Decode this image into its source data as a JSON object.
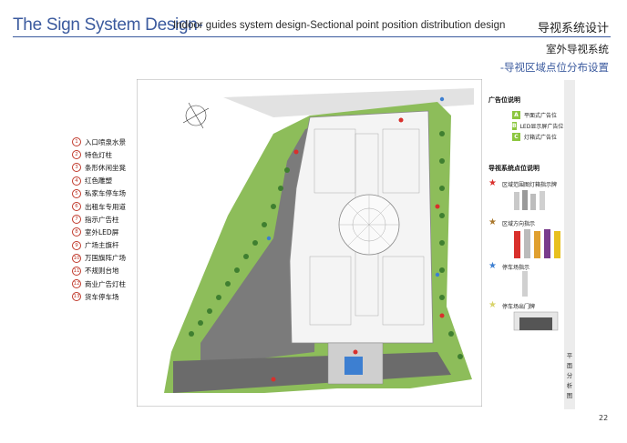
{
  "header": {
    "title": "The Sign System Design-",
    "subtitle": "Indoor guides system design-Sectional point position distribution design",
    "title_cn": "导视系统设计",
    "section_cn": "室外导视系统",
    "subsection_cn": "-导视区域点位分布设置"
  },
  "legend": [
    {
      "num": "1",
      "label": "入口喷泉水景"
    },
    {
      "num": "2",
      "label": "特色灯柱"
    },
    {
      "num": "3",
      "label": "条形休闲坐凳"
    },
    {
      "num": "4",
      "label": "红色雕塑"
    },
    {
      "num": "5",
      "label": "私家车停车场"
    },
    {
      "num": "6",
      "label": "出租车专用道"
    },
    {
      "num": "7",
      "label": "指示广告柱"
    },
    {
      "num": "8",
      "label": "室外LED屏"
    },
    {
      "num": "9",
      "label": "广场主旗杆"
    },
    {
      "num": "10",
      "label": "万国旗阵广场"
    },
    {
      "num": "11",
      "label": "不规则台地"
    },
    {
      "num": "12",
      "label": "商业广告灯柱"
    },
    {
      "num": "13",
      "label": "货车停车场"
    }
  ],
  "ad_legend": {
    "title": "广告位说明",
    "items": [
      {
        "badge": "A",
        "label": "平面式广告位"
      },
      {
        "badge": "B",
        "label": "LED显示屏广告位"
      },
      {
        "badge": "C",
        "label": "灯箱式广告位"
      }
    ]
  },
  "sign_legend": {
    "title": "导视系统点位说明",
    "items": [
      {
        "label": "区域范围图灯箱指示牌",
        "color": "#d9302c"
      },
      {
        "label": "区域方向指示",
        "color": "#a9772c"
      },
      {
        "label": "停车场指示",
        "color": "#3d7fd1"
      },
      {
        "label": "停车场出门牌",
        "color": "#d8d36a"
      }
    ]
  },
  "sidebar_text": "平面分析图",
  "page_number": "22"
}
